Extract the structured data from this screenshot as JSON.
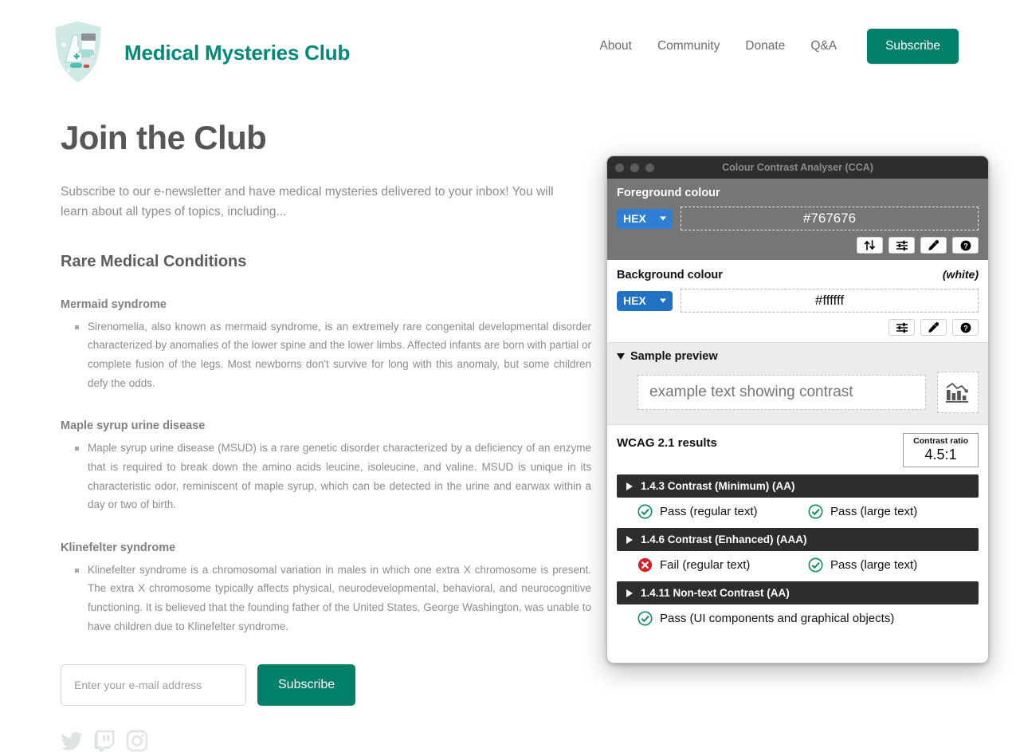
{
  "site": {
    "brand": {
      "name": "Medical Mysteries Club",
      "logo_icon": "medical-shield-logo",
      "color": "#018978"
    },
    "nav": {
      "links": [
        {
          "label": "About"
        },
        {
          "label": "Community"
        },
        {
          "label": "Donate"
        },
        {
          "label": "Q&A"
        }
      ],
      "cta_label": "Subscribe",
      "cta_color": "#018069"
    },
    "main": {
      "title": "Join the Club",
      "intro": "Subscribe to our e-newsletter and have medical mysteries delivered to your inbox! You will learn about all types of topics, including...",
      "section_title": "Rare Medical Conditions",
      "topics": [
        {
          "heading": "Mermaid syndrome",
          "body": "Sirenomelia, also known as mermaid syndrome, is an extremely rare congenital developmental disorder characterized by anomalies of the lower spine and the lower limbs. Affected infants are born with partial or complete fusion of the legs. Most newborns don't survive for long with this anomaly, but some children defy the odds."
        },
        {
          "heading": "Maple syrup urine disease",
          "body": "Maple syrup urine disease (MSUD) is a rare genetic disorder characterized by a deficiency of an enzyme that is required to break down the amino acids leucine, isoleucine, and valine. MSUD is unique in its characteristic odor, reminiscent of maple syrup, which can be detected in the urine and earwax within a day or two of birth."
        },
        {
          "heading": "Klinefelter syndrome",
          "body": "Klinefelter syndrome is a chromosomal variation in males in which one extra X chromosome is present. The extra X chromosome typically affects physical, neurodevelopmental, behavioral, and neurocognitive functioning. It is believed that the founding father of the United States, George Washington, was unable to have children due to Klinefelter syndrome."
        }
      ]
    },
    "subscribe_form": {
      "email_placeholder": "Enter your e-mail address",
      "email_value": "",
      "button_label": "Subscribe"
    },
    "socials": [
      {
        "icon": "twitter-icon",
        "label": "Twitter"
      },
      {
        "icon": "twitch-icon",
        "label": "Twitch"
      },
      {
        "icon": "instagram-icon",
        "label": "Instagram"
      }
    ]
  },
  "cca": {
    "window_title": "Colour Contrast Analyser (CCA)",
    "traffic_lights": [
      "close",
      "minimize",
      "maximize"
    ],
    "foreground": {
      "label": "Foreground colour",
      "format": "HEX",
      "value": "#767676",
      "swatch_color": "#767676",
      "tools": [
        {
          "icon": "swap-colours-icon",
          "label": "Swap colours"
        },
        {
          "icon": "sliders-icon",
          "label": "Colour sliders"
        },
        {
          "icon": "eyedropper-icon",
          "label": "Pick colour"
        },
        {
          "icon": "help-icon",
          "label": "Help"
        }
      ]
    },
    "background": {
      "label": "Background colour",
      "note": "(white)",
      "format": "HEX",
      "value": "#ffffff",
      "swatch_color": "#ffffff",
      "tools": [
        {
          "icon": "sliders-icon",
          "label": "Colour sliders"
        },
        {
          "icon": "eyedropper-icon",
          "label": "Pick colour"
        },
        {
          "icon": "help-icon",
          "label": "Help"
        }
      ]
    },
    "sample_preview": {
      "label": "Sample preview",
      "expanded": true,
      "sample_text": "example text showing contrast",
      "graphic_icon": "bar-line-chart-icon"
    },
    "results": {
      "title": "WCAG 2.1 results",
      "ratio_label": "Contrast ratio",
      "ratio_value": "4.5:1",
      "criteria": [
        {
          "label": "1.4.3 Contrast (Minimum) (AA)",
          "expanded": false,
          "results": [
            {
              "status": "pass",
              "text": "Pass (regular text)"
            },
            {
              "status": "pass",
              "text": "Pass (large text)"
            }
          ]
        },
        {
          "label": "1.4.6 Contrast (Enhanced) (AAA)",
          "expanded": false,
          "results": [
            {
              "status": "fail",
              "text": "Fail (regular text)"
            },
            {
              "status": "pass",
              "text": "Pass (large text)"
            }
          ]
        },
        {
          "label": "1.4.11 Non-text Contrast (AA)",
          "expanded": false,
          "results": [
            {
              "status": "pass",
              "text": "Pass (UI components and graphical objects)"
            }
          ]
        }
      ],
      "colors": {
        "pass": "#0f8a5f",
        "fail": "#d81f26",
        "bar": "#2d2d2d"
      }
    }
  }
}
